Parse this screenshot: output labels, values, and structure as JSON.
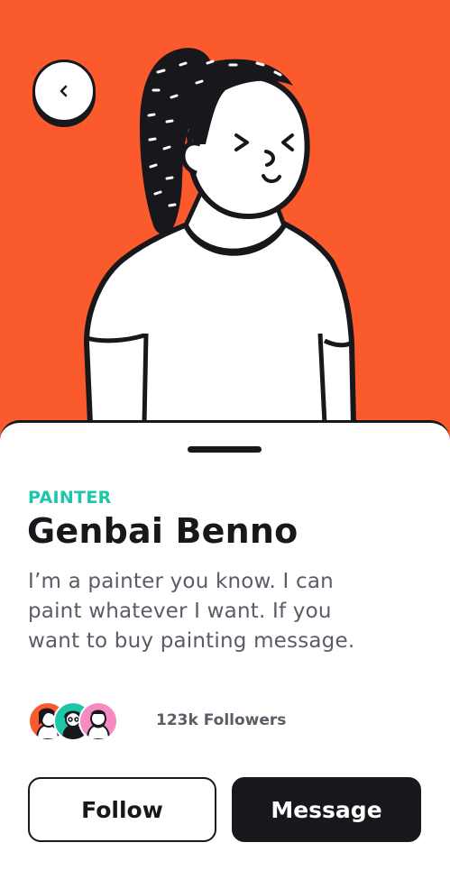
{
  "profile": {
    "role": "PAINTER",
    "name": "Genbai Benno",
    "bio": "I’m a painter you know. I can paint whatever I want. If you want to buy painting message.",
    "followers": "123k Followers"
  },
  "actions": {
    "follow_label": "Follow",
    "message_label": "Message"
  },
  "theme": {
    "hero_background": "#fa5a2c",
    "accent": "#1ec6a8",
    "ink": "#17171c",
    "muted_text": "#5b5c66"
  },
  "icons": {
    "back": "chevron-left-icon"
  }
}
